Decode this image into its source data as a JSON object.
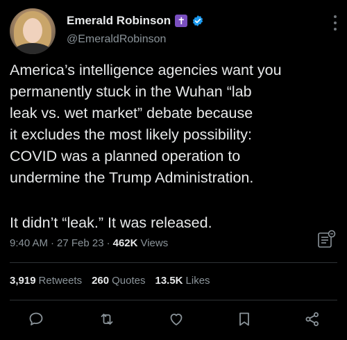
{
  "author": {
    "name": "Emerald Robinson",
    "cross_badge": "✝",
    "handle": "@EmeraldRobinson"
  },
  "tweet": {
    "text_main": "America’s intelligence agencies want you\npermanently stuck in the Wuhan “lab\nleak vs. wet market” debate because\nit excludes the most likely possibility:\nCOVID was a planned operation to\nundermine the Trump Administration.",
    "text_tail": "It didn’t “leak.” It was released."
  },
  "meta": {
    "time": "9:40 AM",
    "sep1": "·",
    "date": "27 Feb 23",
    "sep2": "·",
    "views_count": "462K",
    "views_label": "Views"
  },
  "stats": {
    "retweets_count": "3,919",
    "retweets_label": "Retweets",
    "quotes_count": "260",
    "quotes_label": "Quotes",
    "likes_count": "13.5K",
    "likes_label": "Likes"
  },
  "icons": {
    "verified": "verified-badge-icon",
    "more": "more-options-icon",
    "analytics": "analytics-icon",
    "reply": "reply-icon",
    "retweet": "retweet-icon",
    "like": "like-heart-icon",
    "bookmark": "bookmark-icon",
    "share": "share-icon"
  },
  "colors": {
    "background": "#000000",
    "text": "#e7e9ea",
    "secondary": "#8b949a",
    "verified": "#1d9bf0",
    "cross_badge": "#7a4fbf"
  }
}
